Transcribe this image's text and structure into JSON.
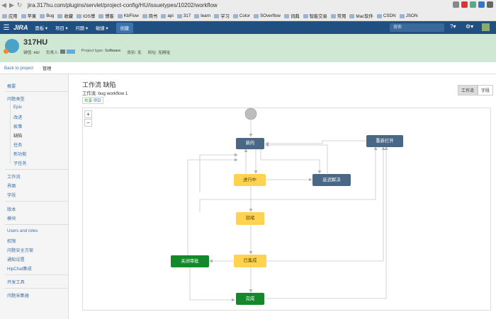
{
  "browser": {
    "url": "jira.317hu.com/plugins/servlet/project-config/HU/issuetypes/10202/workflow",
    "bookmarks": [
      "应用",
      "苹果",
      "Bug",
      "收藏",
      "IOS博",
      "博客",
      "KbFlow",
      "简书",
      "api",
      "317",
      "learn",
      "学习",
      "Color",
      "SOverflow",
      "词典",
      "智能交易",
      "常用",
      "Mac软件",
      "CSDN",
      "JSON"
    ]
  },
  "topnav": {
    "logo": "JIRA",
    "items": [
      "面板",
      "项目",
      "问题",
      "敏捷"
    ],
    "create": "创建",
    "search_placeholder": "搜索"
  },
  "project": {
    "name": "317HU",
    "key_label": "键值:",
    "key": "HU",
    "lead_label": "负责人:",
    "type_label": "Project type:",
    "type": "Software",
    "category_label": "类别:",
    "category": "无",
    "url_label": "网址:",
    "url": "无网址"
  },
  "subnav": {
    "back": "Back to project",
    "manage": "管理"
  },
  "sidebar": {
    "overview": "概要",
    "issue_types": "问题类型",
    "types": [
      "Epic",
      "改进",
      "故事",
      "缺陷",
      "任务",
      "新功能",
      "子任务"
    ],
    "group2": [
      "工作流",
      "界面",
      "字段"
    ],
    "group3": [
      "版本",
      "模块"
    ],
    "group4": [
      "Users and roles",
      "权限",
      "问题安全方案",
      "通知设置",
      "HipChat集成"
    ],
    "group5": [
      "开发工具"
    ],
    "group6": [
      "问题采集器"
    ]
  },
  "workflow": {
    "title": "工作流 缺陷",
    "subtitle": "工作流: bug workflow 1",
    "shared": "共享",
    "shared_link": "项目",
    "view_diagram": "工作流",
    "view_text": "字段",
    "zoom_in": "+",
    "zoom_out": "−",
    "statuses": {
      "new": "新的",
      "in_progress": "进行中",
      "delayed": "延迟解决",
      "reopened": "重新打开",
      "ready": "就绪",
      "integrated": "已集成",
      "closed_review": "关闭审批",
      "done": "完成"
    }
  },
  "colors": {
    "topnav": "#205081",
    "status_grey": "#4a6785",
    "status_yellow": "#ffd351",
    "status_green": "#14892c",
    "link": "#3b73af",
    "header_bg": "#cfe8d3"
  }
}
